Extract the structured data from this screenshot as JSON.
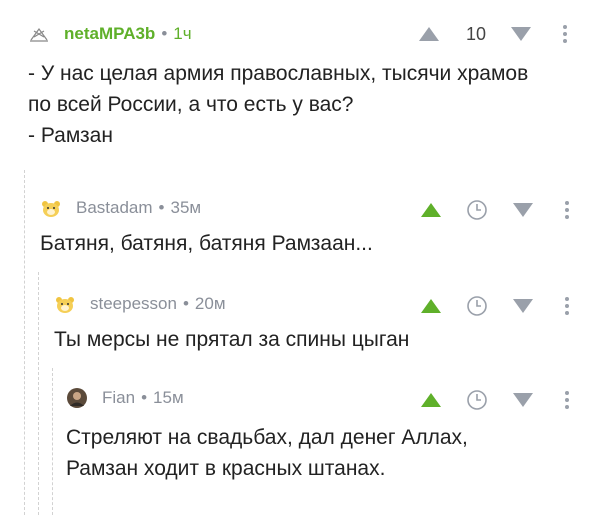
{
  "comments": [
    {
      "author": "netaMPA3b",
      "time": "1ч",
      "rating": "10",
      "avatar_icon": "no-avatar-icon",
      "lines": [
        "- У нас целая армия православных, тысячи храмов",
        "по всей России, а что есть у вас?",
        "- Рамзан"
      ]
    },
    {
      "author": "Bastadam",
      "time": "35м",
      "avatar_icon": "bear-avatar-icon",
      "lines": [
        "Батяня, батяня, батяня Рамзаан..."
      ]
    },
    {
      "author": "steepesson",
      "time": "20м",
      "avatar_icon": "bear-avatar-icon",
      "lines": [
        "Ты мерсы не прятал за спины цыган"
      ]
    },
    {
      "author": "Fian",
      "time": "15м",
      "avatar_icon": "photo-avatar-icon",
      "lines": [
        "Стреляют на свадьбах, дал денег Аллах,",
        "Рамзан ходит в красных штанах."
      ]
    }
  ],
  "separator": "•",
  "colors": {
    "accent_green": "#5fb02a",
    "meta_gray": "#8a8f99",
    "icon_gray": "#9aa0aa",
    "thread_line": "#d2d2d2"
  }
}
